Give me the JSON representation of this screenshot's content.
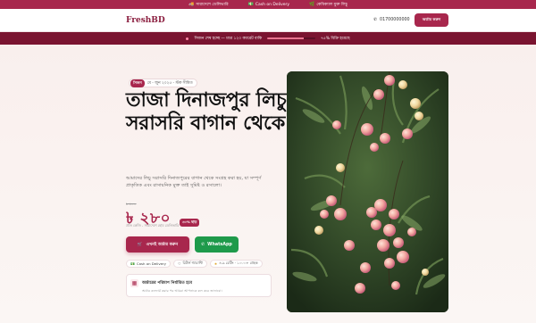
{
  "topbar": {
    "items": [
      {
        "icon": "truck-icon",
        "label": "সারাদেশে ডেলিভারি"
      },
      {
        "icon": "cash-icon",
        "label": "Cash on Delivery"
      },
      {
        "icon": "leaf-icon",
        "label": "কেমিক্যাল মুক্ত লিচু"
      }
    ]
  },
  "nav": {
    "logo": "FreshBD",
    "phone": "01700000000",
    "order_button": "অর্ডার করুন"
  },
  "stock": {
    "text": "সিজন শেষ হচ্ছে — মাত্র ১২০ ক্যারেট বাকি",
    "percent_label": "৭৫% বিক্রি হয়েছে",
    "sold_fraction": 0.75
  },
  "hero": {
    "badge_pill": "সিজন",
    "badge_text": "মে - জুন ২০২৫ - স্টক সীমিত",
    "headline": "তাজা দিনাজপুর লিচু, সরাসরি বাগান থেকে",
    "description": "আমাদের লিচু সরাসরি দিনাজপুরের বাগান থেকে সংগ্রহ করা হয়, যা সম্পূর্ণ প্রাকৃতিক এবং রাসায়নিক মুক্ত তাই সুমিষ্ট ও রসালো।",
    "old_price": "৳ ৪০০",
    "price": "৳ ২৮০",
    "price_note": "প্রতি কেজি - সারাদেশে হোম ডেলিভারি",
    "discount": "৩০% ছাড়",
    "cta": "এখনই অর্ডার করুন",
    "whatsapp": "WhatsApp"
  },
  "trust": [
    {
      "icon": "cash-icon",
      "label": "Cash on Delivery"
    },
    {
      "icon": "shield-icon",
      "label": "রিটার্ন গ্যারান্টি"
    },
    {
      "icon": "star-icon",
      "label": "৪.৯ রেটিং · ১০০০+ গ্রাহক"
    }
  ],
  "notice": {
    "title": "অর্ডারের পরিমাণ নির্ধারিত হবে",
    "subtitle": "অর্ডার কনফার্ম করার পর আমরা আপনাকে কল করে জানাবো।"
  },
  "colors": {
    "accent": "#a8274d",
    "stock_bar": "#7a1430",
    "whatsapp": "#1e9a4b"
  }
}
